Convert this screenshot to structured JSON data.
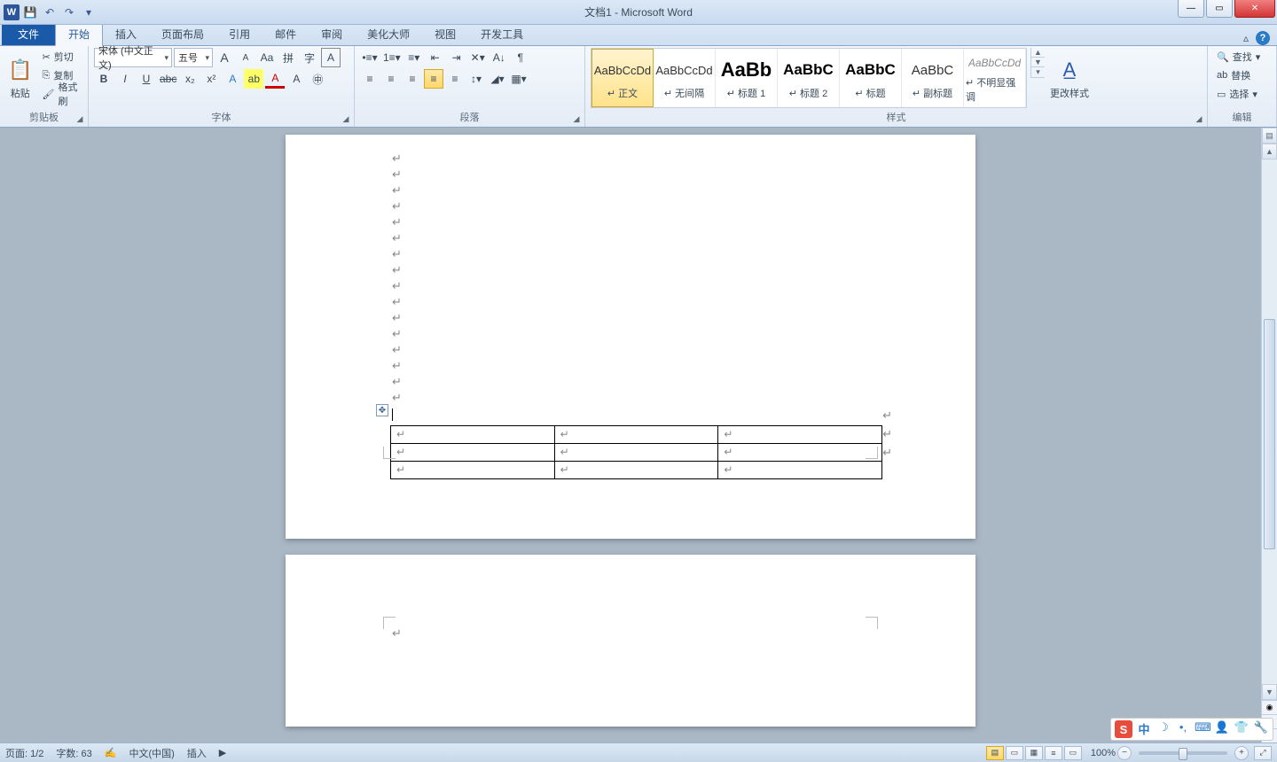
{
  "title": "文档1 - Microsoft Word",
  "qat": {
    "save": "💾",
    "undo": "↶",
    "redo": "↷",
    "dropdown": "▾"
  },
  "tabs": {
    "file": "文件",
    "items": [
      "开始",
      "插入",
      "页面布局",
      "引用",
      "邮件",
      "审阅",
      "美化大师",
      "视图",
      "开发工具"
    ],
    "active_index": 0,
    "minimize": "▵"
  },
  "clipboard": {
    "paste": "粘贴",
    "cut": "剪切",
    "copy": "复制",
    "format_painter": "格式刷",
    "label": "剪贴板"
  },
  "font": {
    "name": "宋体 (中文正文)",
    "size": "五号",
    "grow": "A",
    "shrink": "A",
    "change_case": "Aa",
    "clear": "🧹",
    "phonetic": "拼",
    "char_border": "字",
    "bold": "B",
    "italic": "I",
    "underline": "U",
    "strike": "abc",
    "sub": "x₂",
    "sup": "x²",
    "texteffect": "A",
    "highlight": "ab",
    "fontcolor": "A",
    "charshade": "A",
    "enclose": "㊥",
    "label": "字体"
  },
  "paragraph": {
    "bullets": "≡",
    "numbering": "≡",
    "multilevel": "≡",
    "dec_indent": "⇤",
    "inc_indent": "⇥",
    "sort": "A↓",
    "show_marks": "¶",
    "align_left": "≡",
    "align_center": "≡",
    "align_right": "≡",
    "justify": "≡",
    "line_spacing": "↕",
    "shading": "▦",
    "borders": "▢",
    "label": "段落"
  },
  "styles": {
    "items": [
      {
        "preview": "AaBbCcDd",
        "name": "正文",
        "selected": true,
        "size": "13px",
        "color": "#333"
      },
      {
        "preview": "AaBbCcDd",
        "name": "无间隔",
        "size": "13px",
        "color": "#333"
      },
      {
        "preview": "AaBb",
        "name": "标题 1",
        "size": "22px",
        "color": "#000",
        "bold": true
      },
      {
        "preview": "AaBbC",
        "name": "标题 2",
        "size": "17px",
        "color": "#000",
        "bold": true
      },
      {
        "preview": "AaBbC",
        "name": "标题",
        "size": "17px",
        "color": "#000",
        "bold": true
      },
      {
        "preview": "AaBbC",
        "name": "副标题",
        "size": "15px",
        "color": "#333"
      },
      {
        "preview": "AaBbCcDd",
        "name": "不明显强调",
        "size": "12px",
        "color": "#888",
        "italic": true
      }
    ],
    "change_styles": "更改样式",
    "label": "样式"
  },
  "editing": {
    "find": "查找",
    "replace": "替换",
    "select": "选择",
    "label": "编辑"
  },
  "document": {
    "para_marks_count": 16,
    "table": {
      "rows": 3,
      "cols": 3
    }
  },
  "statusbar": {
    "page": "页面: 1/2",
    "words": "字数: 63",
    "language": "中文(中国)",
    "mode": "插入",
    "zoom": "100%"
  },
  "tray": {
    "ime": "中",
    "moon": "☽",
    "comma": "•,",
    "kb": "⌨",
    "person": "👤",
    "shirt": "👕",
    "wrench": "🔧"
  }
}
